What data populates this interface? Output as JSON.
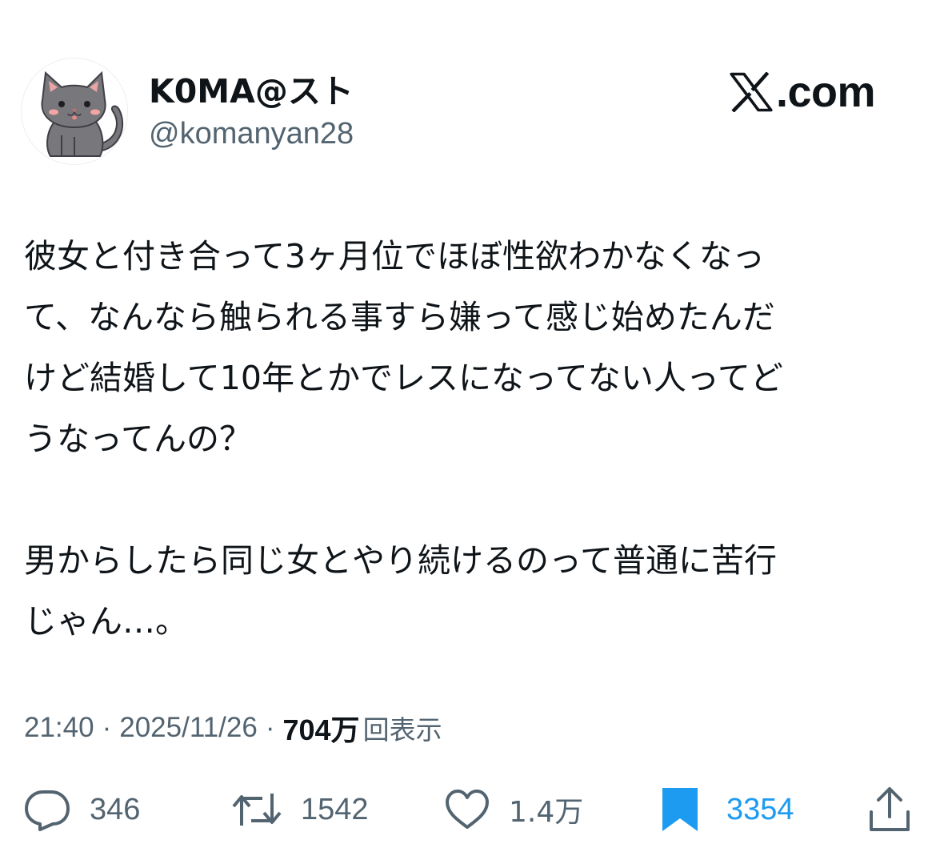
{
  "author": {
    "name": "K0MA@スト",
    "handle": "@komanyan28"
  },
  "brand": {
    "text": ".com"
  },
  "tweet": {
    "paragraph1_lines": [
      "彼女と付き合って3ヶ月位でほぼ性欲わかなくなっ",
      "て、なんなら触られる事すら嫌って感じ始めたんだ",
      "けど結婚して10年とかでレスになってない人ってど",
      "うなってんの？"
    ],
    "paragraph2_lines": [
      "男からしたら同じ女とやり続けるのって普通に苦行",
      "じゃん…。"
    ]
  },
  "meta": {
    "time": "21:40",
    "separator": "·",
    "date": "2025/11/26",
    "views_count": "704万",
    "views_label": "回表示"
  },
  "actions": {
    "reply_count": "346",
    "retweet_count": "1542",
    "like_count": "1.4万",
    "bookmark_count": "3354"
  },
  "colors": {
    "text": "#0f1419",
    "secondary": "#536471",
    "accent": "#1d9bf0"
  },
  "icons": [
    "cat-avatar",
    "x-logo-icon",
    "reply-icon",
    "retweet-icon",
    "like-icon",
    "bookmark-icon",
    "share-icon"
  ]
}
